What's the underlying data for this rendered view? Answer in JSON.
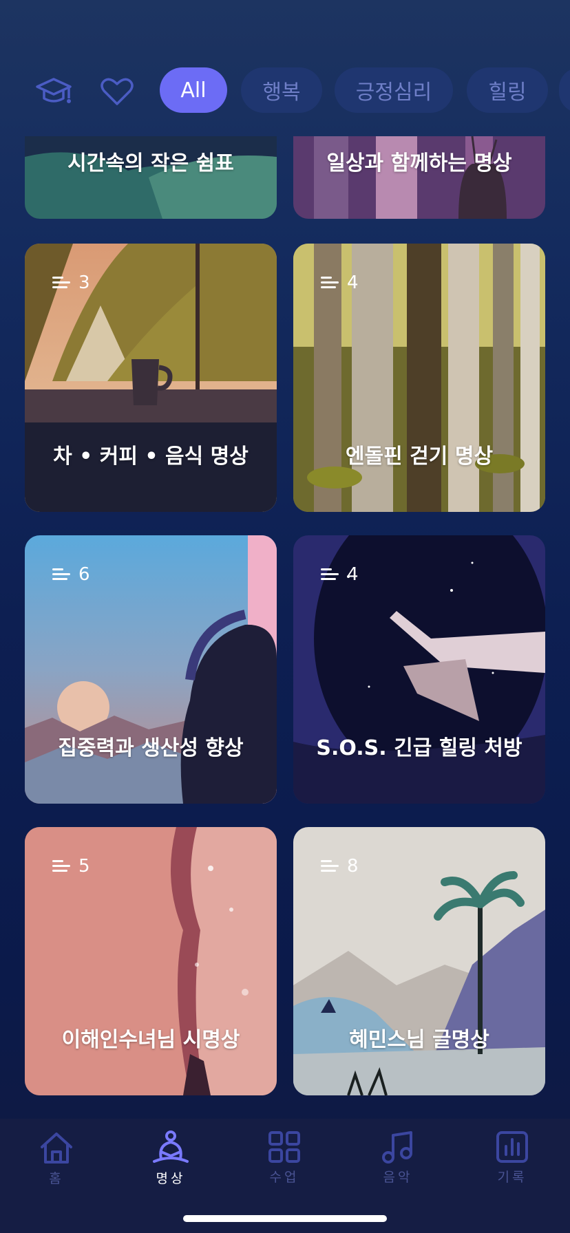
{
  "filters": {
    "chips": [
      {
        "label": "All",
        "active": true
      },
      {
        "label": "행복",
        "active": false
      },
      {
        "label": "긍정심리",
        "active": false
      },
      {
        "label": "힐링",
        "active": false
      }
    ]
  },
  "cards": [
    {
      "title": "시간속의 작은 쉼표"
    },
    {
      "title": "일상과 함께하는 명상"
    },
    {
      "title": "차 • 커피 • 음식 명상",
      "count": "3"
    },
    {
      "title": "엔돌핀 걷기 명상",
      "count": "4"
    },
    {
      "title": "집중력과 생산성 향상",
      "count": "6"
    },
    {
      "title": "S.O.S. 긴급 힐링 처방",
      "count": "4"
    },
    {
      "title": "이해인수녀님 시명상",
      "count": "5"
    },
    {
      "title": "혜민스님 글명상",
      "count": "8"
    }
  ],
  "tabbar": {
    "tabs": [
      {
        "label": "홈",
        "icon": "home-icon"
      },
      {
        "label": "명상",
        "icon": "meditation-icon",
        "active": true
      },
      {
        "label": "수업",
        "icon": "grid-icon"
      },
      {
        "label": "음악",
        "icon": "music-note-icon"
      },
      {
        "label": "기록",
        "icon": "chart-icon"
      }
    ]
  },
  "colors": {
    "accent": "#6c6cf5",
    "inactive": "#4a5494"
  }
}
